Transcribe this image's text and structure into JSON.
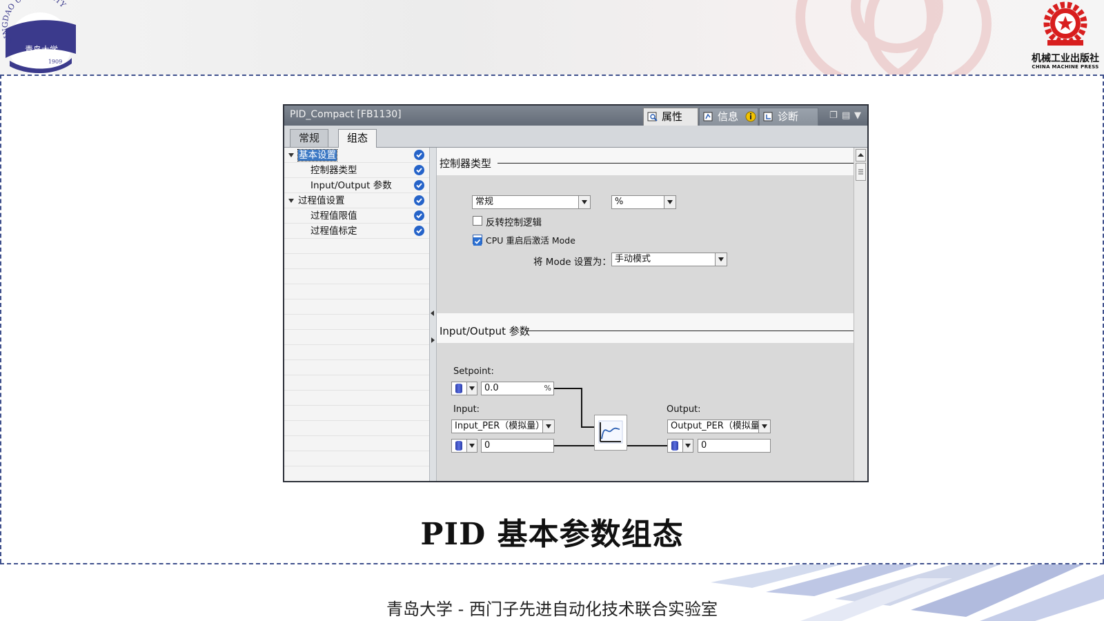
{
  "slide": {
    "title": "PID 基本参数组态",
    "footer": "青岛大学 - 西门子先进自动化技术联合实验室",
    "university_logo_text": "QINGDAO UNIVERSITY",
    "university_logo_year": "1909",
    "press_name": "机械工业出版社",
    "press_name_en": "CHINA MACHINE PRESS",
    "colors": {
      "dashed_border": "#3e4f8c",
      "logo_blue": "#3b3a8c",
      "press_red": "#d81e1e"
    }
  },
  "window": {
    "title": "PID_Compact [FB1130]",
    "top_tabs": [
      {
        "label": "属性",
        "icon": "properties-icon"
      },
      {
        "label": "信息",
        "icon": "info-icon"
      },
      {
        "label": "诊断",
        "icon": "diagnostics-icon"
      }
    ],
    "sub_tabs": [
      {
        "label": "常规"
      },
      {
        "label": "组态"
      }
    ],
    "nav": [
      {
        "label": "基本设置"
      },
      {
        "label": "控制器类型"
      },
      {
        "label": "Input/Output 参数"
      },
      {
        "label": "过程值设置"
      },
      {
        "label": "过程值限值"
      },
      {
        "label": "过程值标定"
      }
    ],
    "controller_type": {
      "heading": "控制器类型",
      "type_value": "常规",
      "unit_value": "%",
      "invert_label": "反转控制逻辑",
      "invert_checked": false,
      "restart_label": "CPU 重启后激活 Mode",
      "restart_checked": true,
      "mode_label": "将 Mode 设置为：",
      "mode_value": "手动模式"
    },
    "io": {
      "heading": "Input/Output 参数",
      "setpoint_label": "Setpoint:",
      "setpoint_value": "0.0",
      "setpoint_unit": "%",
      "input_label": "Input:",
      "input_type": "Input_PER（模拟量）",
      "input_value": "0",
      "output_label": "Output:",
      "output_type": "Output_PER（模拟量）",
      "output_value": "0"
    }
  }
}
